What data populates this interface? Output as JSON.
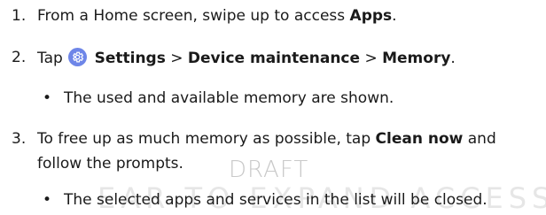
{
  "steps": [
    {
      "num": "1.",
      "pre": "From a Home screen, swipe up to access ",
      "bold": "Apps",
      "post": "."
    },
    {
      "num": "2.",
      "pre": "Tap",
      "icon": "settings-gear-icon",
      "b1": "Settings",
      "sep1": " > ",
      "b2": "Device maintenance",
      "sep2": " > ",
      "b3": "Memory",
      "post": "."
    }
  ],
  "bullet1": "The used and available memory are shown.",
  "step3": {
    "num": "3.",
    "pre": "To free up as much memory as possible, tap ",
    "bold": "Clean now",
    "post": " and",
    "line2": "follow the prompts."
  },
  "bullet2": "The selected apps and services in the list will be closed.",
  "watermark": "DRAFT",
  "colors": {
    "text": "#1a1a1a",
    "icon_bg": "#6e86e8",
    "watermark": "#c9c9c9"
  }
}
